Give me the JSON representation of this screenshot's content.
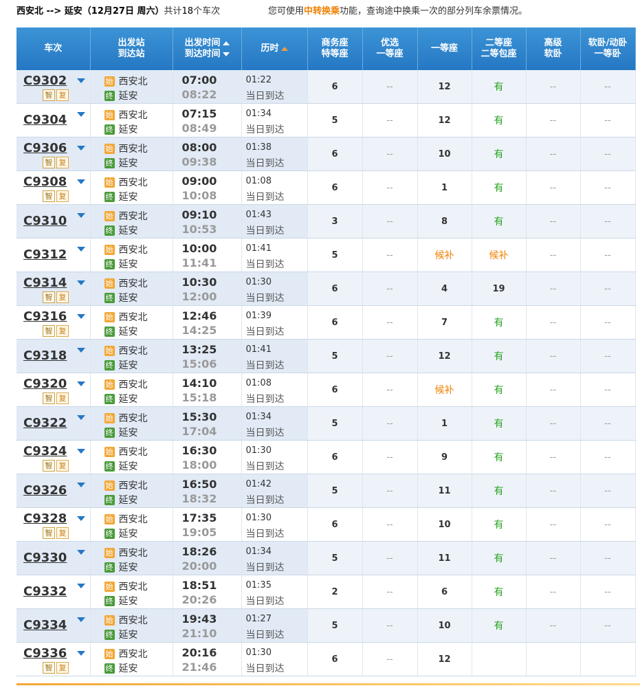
{
  "header": {
    "from": "西安北",
    "arrow": " --> ",
    "to": "延安",
    "date": "（12月27日  周六）",
    "count_prefix": "共计",
    "count": "18",
    "count_suffix": "个车次",
    "tip_prefix": "您可使用",
    "tip_link": "中转换乘",
    "tip_suffix": "功能，查询途中换乘一次的部分列车余票情况。"
  },
  "columns": {
    "train": "车次",
    "station_from": "出发站",
    "station_to": "到达站",
    "time_dep": "出发时间",
    "time_arr": "到达时间",
    "duration": "历时",
    "biz_1": "商务座",
    "biz_2": "特等座",
    "pref_1": "优选",
    "pref_2": "一等座",
    "first": "一等座",
    "second_1": "二等座",
    "second_2": "二等包座",
    "soft_1": "高级",
    "soft_2": "软卧",
    "sleep_1": "软卧/动卧",
    "sleep_2": "一等卧"
  },
  "labels": {
    "start_badge": "始",
    "end_badge": "终",
    "tag_zhi": "智",
    "tag_fu": "复",
    "same_day": "当日到达"
  },
  "trains": [
    {
      "no": "C9302",
      "tags": true,
      "from": "西安北",
      "to": "延安",
      "dep": "07:00",
      "arr": "08:22",
      "dur": "01:22",
      "biz": "6",
      "pref": "--",
      "first": "12",
      "second": "有",
      "soft": "--",
      "sleep": "--"
    },
    {
      "no": "C9304",
      "tags": false,
      "from": "西安北",
      "to": "延安",
      "dep": "07:15",
      "arr": "08:49",
      "dur": "01:34",
      "biz": "5",
      "pref": "--",
      "first": "12",
      "second": "有",
      "soft": "--",
      "sleep": "--"
    },
    {
      "no": "C9306",
      "tags": true,
      "from": "西安北",
      "to": "延安",
      "dep": "08:00",
      "arr": "09:38",
      "dur": "01:38",
      "biz": "6",
      "pref": "--",
      "first": "10",
      "second": "有",
      "soft": "--",
      "sleep": "--"
    },
    {
      "no": "C9308",
      "tags": true,
      "from": "西安北",
      "to": "延安",
      "dep": "09:00",
      "arr": "10:08",
      "dur": "01:08",
      "biz": "6",
      "pref": "--",
      "first": "1",
      "second": "有",
      "soft": "--",
      "sleep": "--"
    },
    {
      "no": "C9310",
      "tags": false,
      "from": "西安北",
      "to": "延安",
      "dep": "09:10",
      "arr": "10:53",
      "dur": "01:43",
      "biz": "3",
      "pref": "--",
      "first": "8",
      "second": "有",
      "soft": "--",
      "sleep": "--"
    },
    {
      "no": "C9312",
      "tags": false,
      "from": "西安北",
      "to": "延安",
      "dep": "10:00",
      "arr": "11:41",
      "dur": "01:41",
      "biz": "5",
      "pref": "--",
      "first": "候补",
      "second": "候补",
      "soft": "--",
      "sleep": "--"
    },
    {
      "no": "C9314",
      "tags": true,
      "from": "西安北",
      "to": "延安",
      "dep": "10:30",
      "arr": "12:00",
      "dur": "01:30",
      "biz": "6",
      "pref": "--",
      "first": "4",
      "second": "19",
      "soft": "--",
      "sleep": "--"
    },
    {
      "no": "C9316",
      "tags": true,
      "from": "西安北",
      "to": "延安",
      "dep": "12:46",
      "arr": "14:25",
      "dur": "01:39",
      "biz": "6",
      "pref": "--",
      "first": "7",
      "second": "有",
      "soft": "--",
      "sleep": "--"
    },
    {
      "no": "C9318",
      "tags": false,
      "from": "西安北",
      "to": "延安",
      "dep": "13:25",
      "arr": "15:06",
      "dur": "01:41",
      "biz": "5",
      "pref": "--",
      "first": "12",
      "second": "有",
      "soft": "--",
      "sleep": "--"
    },
    {
      "no": "C9320",
      "tags": true,
      "from": "西安北",
      "to": "延安",
      "dep": "14:10",
      "arr": "15:18",
      "dur": "01:08",
      "biz": "6",
      "pref": "--",
      "first": "候补",
      "second": "有",
      "soft": "--",
      "sleep": "--"
    },
    {
      "no": "C9322",
      "tags": false,
      "from": "西安北",
      "to": "延安",
      "dep": "15:30",
      "arr": "17:04",
      "dur": "01:34",
      "biz": "5",
      "pref": "--",
      "first": "1",
      "second": "有",
      "soft": "--",
      "sleep": "--"
    },
    {
      "no": "C9324",
      "tags": true,
      "from": "西安北",
      "to": "延安",
      "dep": "16:30",
      "arr": "18:00",
      "dur": "01:30",
      "biz": "6",
      "pref": "--",
      "first": "9",
      "second": "有",
      "soft": "--",
      "sleep": "--"
    },
    {
      "no": "C9326",
      "tags": false,
      "from": "西安北",
      "to": "延安",
      "dep": "16:50",
      "arr": "18:32",
      "dur": "01:42",
      "biz": "5",
      "pref": "--",
      "first": "11",
      "second": "有",
      "soft": "--",
      "sleep": "--"
    },
    {
      "no": "C9328",
      "tags": true,
      "from": "西安北",
      "to": "延安",
      "dep": "17:35",
      "arr": "19:05",
      "dur": "01:30",
      "biz": "6",
      "pref": "--",
      "first": "10",
      "second": "有",
      "soft": "--",
      "sleep": "--"
    },
    {
      "no": "C9330",
      "tags": false,
      "from": "西安北",
      "to": "延安",
      "dep": "18:26",
      "arr": "20:00",
      "dur": "01:34",
      "biz": "5",
      "pref": "--",
      "first": "11",
      "second": "有",
      "soft": "--",
      "sleep": "--"
    },
    {
      "no": "C9332",
      "tags": false,
      "from": "西安北",
      "to": "延安",
      "dep": "18:51",
      "arr": "20:26",
      "dur": "01:35",
      "biz": "2",
      "pref": "--",
      "first": "6",
      "second": "有",
      "soft": "--",
      "sleep": "--"
    },
    {
      "no": "C9334",
      "tags": false,
      "from": "西安北",
      "to": "延安",
      "dep": "19:43",
      "arr": "21:10",
      "dur": "01:27",
      "biz": "5",
      "pref": "--",
      "first": "10",
      "second": "有",
      "soft": "--",
      "sleep": "--"
    },
    {
      "no": "C9336",
      "tags": true,
      "from": "西安北",
      "to": "延安",
      "dep": "20:16",
      "arr": "21:46",
      "dur": "01:30",
      "biz": "6",
      "pref": "--",
      "first": "12",
      "second": "",
      "soft": "",
      "sleep": ""
    }
  ]
}
